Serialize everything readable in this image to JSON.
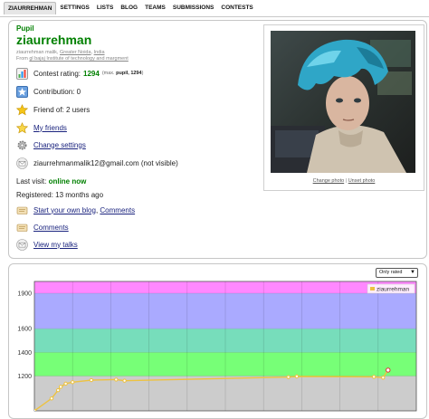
{
  "menu": {
    "items": [
      {
        "label": "ziaurrehman",
        "active": true
      },
      {
        "label": "SETTINGS"
      },
      {
        "label": "LISTS"
      },
      {
        "label": "BLOG"
      },
      {
        "label": "TEAMS"
      },
      {
        "label": "SUBMISSIONS"
      },
      {
        "label": "CONTESTS"
      }
    ]
  },
  "profile": {
    "rank": "Pupil",
    "handle": "ziaurrehman",
    "real_name": "ziaurrehman malik,",
    "city": "Greater Noida",
    "country": "India",
    "org_prefix": "From",
    "org": "gl bajaj Institute of technology and margment",
    "rating_label": "Contest rating:",
    "rating_value": "1294",
    "rating_max_open": "(max.",
    "rating_max_rank": "pupil,",
    "rating_max_value": "1294",
    "rating_max_close": ")",
    "contribution": "Contribution: 0",
    "friend_of": "Friend of: 2 users",
    "my_friends": "My friends",
    "change_settings": "Change settings",
    "email": "ziaurrehmanmalik12@gmail.com (not visible)",
    "last_visit_label": "Last visit:",
    "last_visit_value": "online now",
    "registered": "Registered: 13 months ago",
    "blog_link": "Start your own blog",
    "blog_sep": ",",
    "comments_link_1": "Comments",
    "comments_link_2": "Comments",
    "talks": "View my talks",
    "change_photo": "Change photo",
    "photo_sep": "|",
    "unset_photo": "Unset photo"
  },
  "chart_controls": {
    "select_value": "Only rated",
    "select_caret": "▼"
  },
  "colors": {
    "green": "#008000",
    "link": "#1a237e",
    "band_newbie": "#cccccc",
    "band_pupil": "#77ff77",
    "band_specialist": "#77ddbb",
    "band_expert": "#aaaaff",
    "band_cm": "#ff88ff",
    "line": "#edc240"
  },
  "chart_data": {
    "type": "line",
    "yticks": [
      1200,
      1400,
      1600,
      1900
    ],
    "ylim": [
      905,
      2000
    ],
    "xlim": [
      0,
      100
    ],
    "bands": [
      {
        "from": 0,
        "to": 1200,
        "color": "#cccccc"
      },
      {
        "from": 1200,
        "to": 1400,
        "color": "#77ff77"
      },
      {
        "from": 1400,
        "to": 1600,
        "color": "#77ddbb"
      },
      {
        "from": 1600,
        "to": 1900,
        "color": "#aaaaff"
      },
      {
        "from": 1900,
        "to": 3000,
        "color": "#ff88ff"
      }
    ],
    "vgrid_x": [
      10,
      20,
      30,
      40,
      50,
      60,
      70,
      80,
      90
    ],
    "series": [
      {
        "name": "ziaurrehman",
        "x": [
          0,
          4.5,
          6.2,
          6.9,
          8.2,
          10.0,
          14.9,
          21.4,
          23.6,
          66.5,
          68.7,
          88.9,
          91.3,
          92.6
        ],
        "y": [
          905,
          1010,
          1080,
          1108,
          1135,
          1148,
          1165,
          1170,
          1160,
          1191,
          1196,
          1193,
          1186,
          1250
        ]
      }
    ]
  }
}
